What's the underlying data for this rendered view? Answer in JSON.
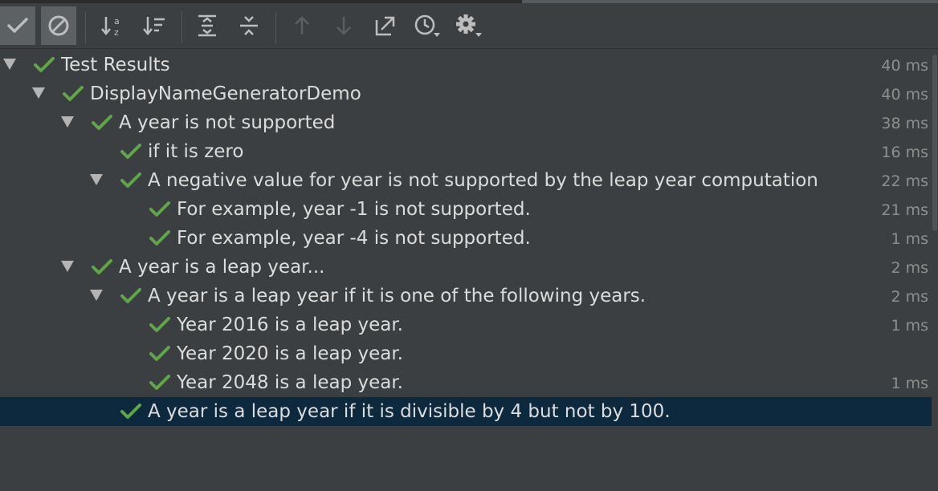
{
  "colors": {
    "background": "#3c3f41",
    "selection": "#0d293e",
    "pass_check": "#5fa645",
    "text": "#dcdcdc",
    "time_text": "#8e8e8e"
  },
  "toolbar": {
    "buttons": [
      {
        "name": "show-passed",
        "icon": "check-icon",
        "pressed": true
      },
      {
        "name": "show-ignored",
        "icon": "ignored-icon",
        "pressed": true
      },
      {
        "name": "sort-alphabetically",
        "icon": "sort-alpha-icon",
        "pressed": false
      },
      {
        "name": "sort-by-duration",
        "icon": "sort-duration-icon",
        "pressed": false
      },
      {
        "name": "expand-all",
        "icon": "expand-all-icon",
        "pressed": false
      },
      {
        "name": "collapse-all",
        "icon": "collapse-all-icon",
        "pressed": false
      },
      {
        "name": "previous-failed",
        "icon": "arrow-up-icon",
        "pressed": false,
        "disabled": true
      },
      {
        "name": "next-failed",
        "icon": "arrow-down-icon",
        "pressed": false,
        "disabled": true
      },
      {
        "name": "export-results",
        "icon": "export-icon",
        "pressed": false
      },
      {
        "name": "test-history",
        "icon": "history-clock-icon",
        "pressed": false
      },
      {
        "name": "settings",
        "icon": "gear-icon",
        "pressed": false
      }
    ]
  },
  "tree": {
    "rows": [
      {
        "label": "Test Results",
        "time": "40 ms",
        "depth": 0,
        "expanded": true,
        "status": "passed"
      },
      {
        "label": "DisplayNameGeneratorDemo",
        "time": "40 ms",
        "depth": 1,
        "expanded": true,
        "status": "passed"
      },
      {
        "label": "A year is not supported",
        "time": "38 ms",
        "depth": 2,
        "expanded": true,
        "status": "passed"
      },
      {
        "label": "if it is zero",
        "time": "16 ms",
        "depth": 3,
        "expanded": null,
        "status": "passed"
      },
      {
        "label": "A negative value for year is not supported by the leap year computation",
        "time": "22 ms",
        "depth": 3,
        "expanded": true,
        "status": "passed"
      },
      {
        "label": "For example, year -1 is not supported.",
        "time": "21 ms",
        "depth": 4,
        "expanded": null,
        "status": "passed"
      },
      {
        "label": "For example, year -4 is not supported.",
        "time": "1 ms",
        "depth": 4,
        "expanded": null,
        "status": "passed"
      },
      {
        "label": "A year is a leap year...",
        "time": "2 ms",
        "depth": 2,
        "expanded": true,
        "status": "passed"
      },
      {
        "label": "A year is a leap year if it is one of the following years.",
        "time": "2 ms",
        "depth": 3,
        "expanded": true,
        "status": "passed"
      },
      {
        "label": "Year 2016 is a leap year.",
        "time": "1 ms",
        "depth": 4,
        "expanded": null,
        "status": "passed"
      },
      {
        "label": "Year 2020 is a leap year.",
        "time": "",
        "depth": 4,
        "expanded": null,
        "status": "passed"
      },
      {
        "label": "Year 2048 is a leap year.",
        "time": "1 ms",
        "depth": 4,
        "expanded": null,
        "status": "passed"
      },
      {
        "label": "A year is a leap year if it is divisible by 4 but not by 100.",
        "time": "",
        "depth": 3,
        "expanded": null,
        "status": "passed",
        "selected": true
      }
    ]
  }
}
